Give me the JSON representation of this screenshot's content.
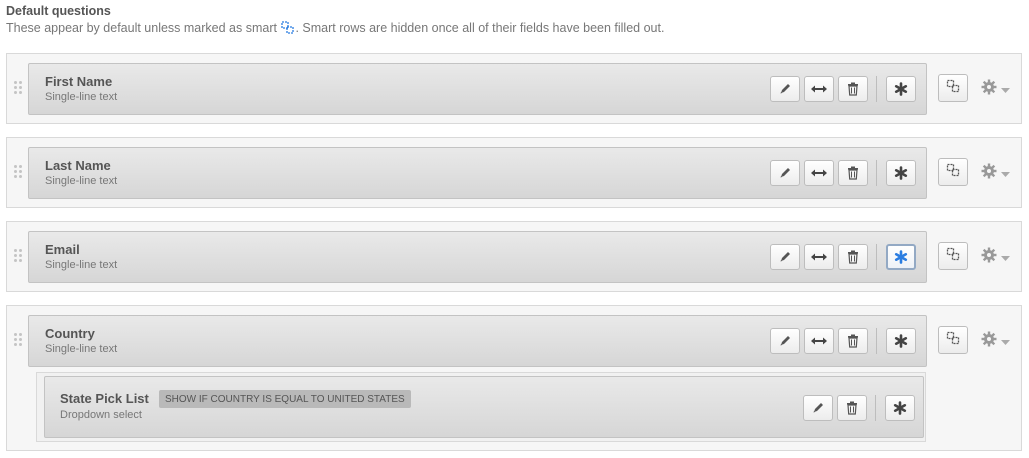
{
  "section": {
    "title": "Default questions",
    "desc_before": "These appear by default unless marked as smart",
    "desc_after": ". Smart rows are hidden once all of their fields have been filled out."
  },
  "fields": [
    {
      "name": "First Name",
      "type": "Single-line text",
      "required_active": false
    },
    {
      "name": "Last Name",
      "type": "Single-line text",
      "required_active": false
    },
    {
      "name": "Email",
      "type": "Single-line text",
      "required_active": true
    },
    {
      "name": "Country",
      "type": "Single-line text",
      "required_active": false
    }
  ],
  "child_field": {
    "name": "State Pick List",
    "type": "Dropdown select",
    "condition": "SHOW IF COUNTRY IS EQUAL TO UNITED STATES"
  },
  "icons": {
    "edit": "pencil-icon",
    "width": "double-arrow-icon",
    "delete": "trash-icon",
    "required": "asterisk-icon",
    "smart": "smart-link-icon",
    "settings": "gear-icon",
    "caret": "caret-down-icon",
    "drag": "drag-grip-icon"
  },
  "colors": {
    "required_active": "#2a7de1",
    "required_inactive": "#444444",
    "smart_icon": "#2a7de1"
  }
}
